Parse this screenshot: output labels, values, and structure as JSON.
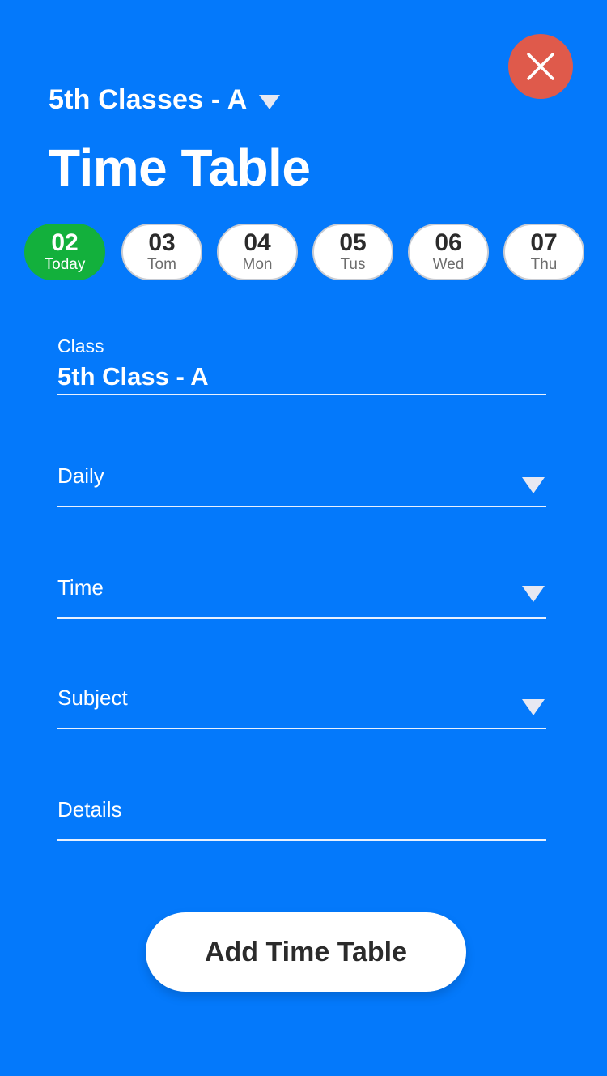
{
  "header": {
    "class_selector_label": "5th Classes - A",
    "title": "Time Table"
  },
  "dates": [
    {
      "day": "02",
      "label": "Today",
      "active": true
    },
    {
      "day": "03",
      "label": "Tom",
      "active": false
    },
    {
      "day": "04",
      "label": "Mon",
      "active": false
    },
    {
      "day": "05",
      "label": "Tus",
      "active": false
    },
    {
      "day": "06",
      "label": "Wed",
      "active": false
    },
    {
      "day": "07",
      "label": "Thu",
      "active": false
    }
  ],
  "form": {
    "class_label": "Class",
    "class_value": "5th Class - A",
    "daily_placeholder": "Daily",
    "time_placeholder": "Time",
    "subject_placeholder": "Subject",
    "details_placeholder": "Details"
  },
  "actions": {
    "add_button_label": "Add Time Table"
  },
  "colors": {
    "background": "#0479FB",
    "close_button": "#DF5A4B",
    "active_date": "#13B03C"
  },
  "icons": {
    "close": "close-icon",
    "dropdown": "chevron-down-icon"
  }
}
